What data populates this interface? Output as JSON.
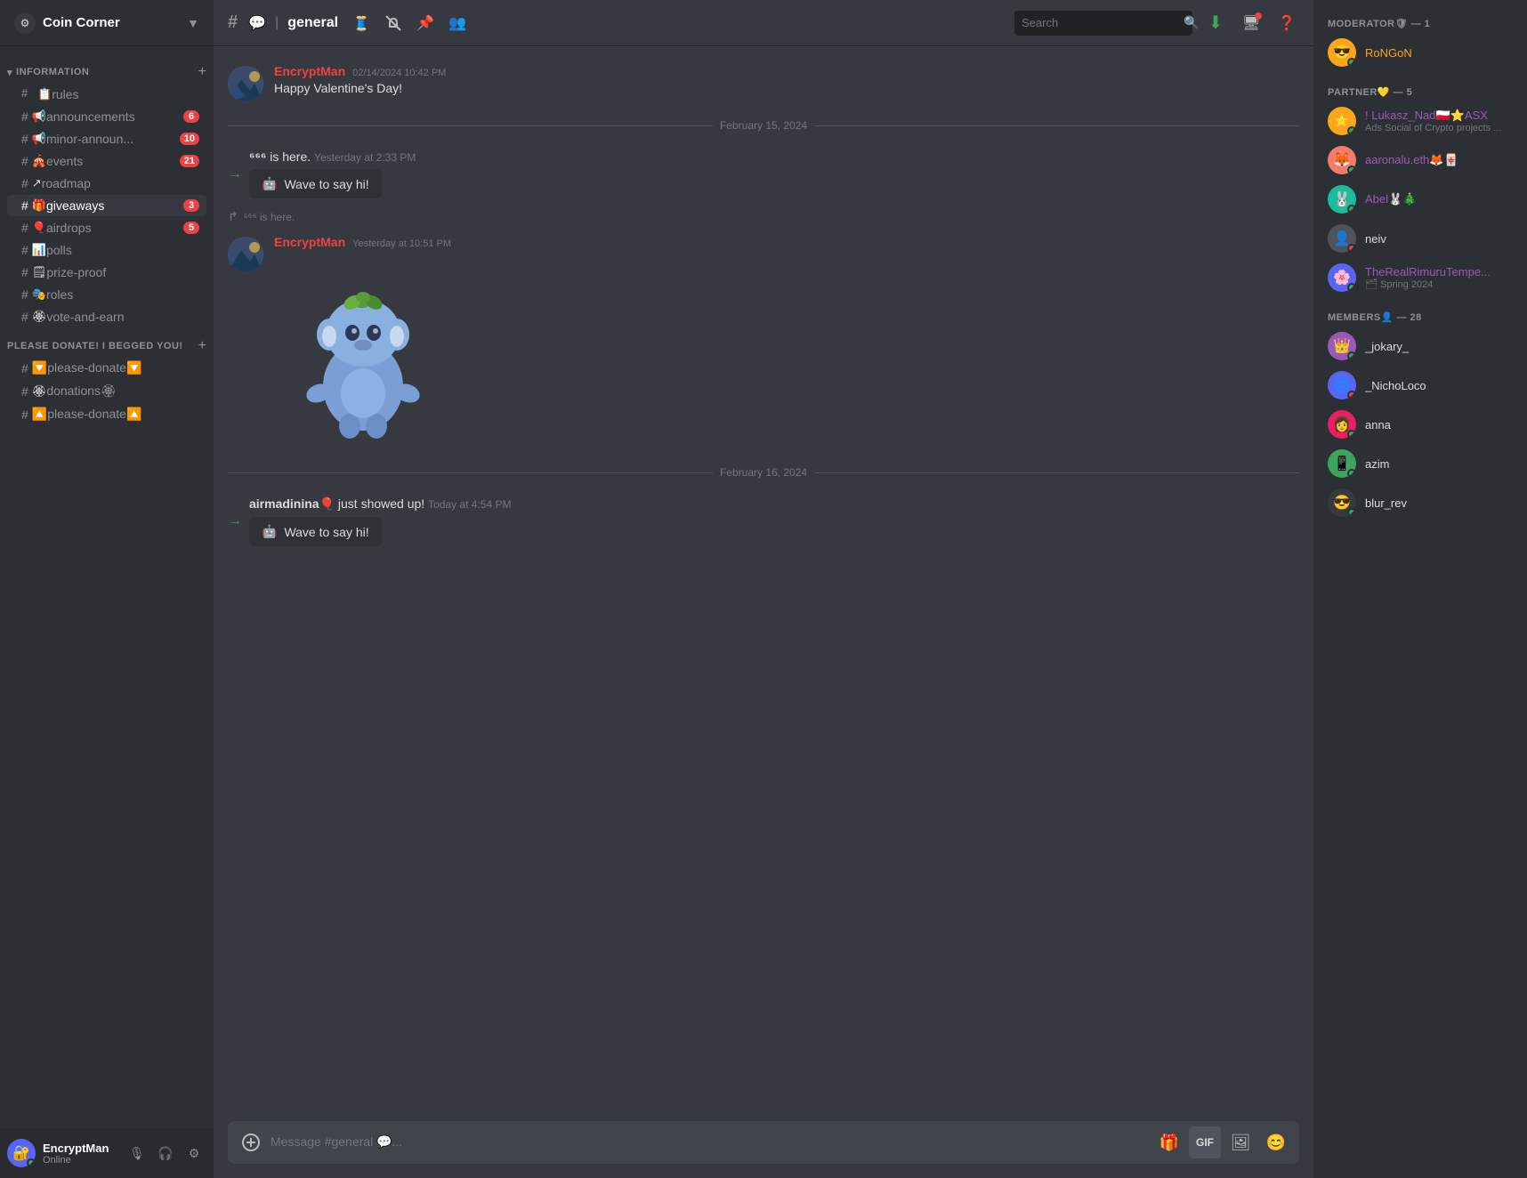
{
  "server": {
    "name": "Coin Corner",
    "icon": "⚙"
  },
  "sidebar": {
    "categories": [
      {
        "id": "information",
        "label": "INFORMATION",
        "collapsed": false,
        "channels": [
          {
            "id": "rules",
            "name": "rules",
            "icon": "📋",
            "type": "text",
            "badge": null,
            "emoji": ""
          },
          {
            "id": "announcements",
            "name": "announcements",
            "icon": "📢",
            "type": "text",
            "badge": 6,
            "emoji": ""
          },
          {
            "id": "minor-announ",
            "name": "minor-announ...",
            "icon": "📢",
            "type": "text",
            "badge": 10,
            "emoji": ""
          },
          {
            "id": "events",
            "name": "events",
            "icon": "🎪",
            "type": "text",
            "badge": 21,
            "emoji": ""
          },
          {
            "id": "roadmap",
            "name": "roadmap",
            "icon": "↗",
            "type": "text",
            "badge": null,
            "emoji": ""
          },
          {
            "id": "giveaways",
            "name": "giveaways",
            "icon": "🎁",
            "type": "text",
            "badge": 3,
            "emoji": ""
          },
          {
            "id": "airdrops",
            "name": "airdrops",
            "icon": "🎈",
            "type": "text",
            "badge": 5,
            "emoji": ""
          },
          {
            "id": "polls",
            "name": "polls",
            "icon": "📊",
            "type": "text",
            "badge": null,
            "emoji": ""
          },
          {
            "id": "prize-proof",
            "name": "prize-proof",
            "icon": "🗒",
            "type": "text",
            "badge": null,
            "emoji": ""
          },
          {
            "id": "roles",
            "name": "roles",
            "icon": "🎭",
            "type": "text",
            "badge": null,
            "emoji": ""
          },
          {
            "id": "vote-and-earn",
            "name": "vote-and-earn",
            "icon": "🏵",
            "type": "text",
            "badge": null,
            "emoji": ""
          }
        ]
      },
      {
        "id": "please-donate",
        "label": "PLEASE DONATE! I BEGGED YOU!",
        "collapsed": false,
        "channels": [
          {
            "id": "please-donate-1",
            "name": "🔽please-donate🔽",
            "icon": "",
            "type": "text",
            "badge": null
          },
          {
            "id": "donations",
            "name": "donations🏵",
            "icon": "🏵",
            "type": "text",
            "badge": null
          },
          {
            "id": "please-donate-2",
            "name": "🔼please-donate🔼",
            "icon": "",
            "type": "text",
            "badge": null
          }
        ]
      }
    ],
    "active_channel": "general"
  },
  "channel": {
    "name": "general",
    "hashtag": "#"
  },
  "header": {
    "channel_name": "general",
    "search_placeholder": "Search"
  },
  "messages": [
    {
      "id": "msg1",
      "type": "user",
      "author": "EncryptMan",
      "timestamp": "02/14/2024 10:42 PM",
      "text": "Happy Valentine's Day!",
      "has_image": true,
      "image_type": "avatar_landscape"
    },
    {
      "id": "sys1",
      "type": "system",
      "user": "666",
      "action": "is here.",
      "timestamp": "Yesterday at 2:33 PM",
      "wave": true
    },
    {
      "id": "msg2",
      "type": "user",
      "author": "EncryptMan",
      "timestamp": "Yesterday at 10:51 PM",
      "text": "",
      "has_character": true,
      "reply_text": "666 is here."
    },
    {
      "id": "sys2",
      "type": "system",
      "user": "airmadinina🎈",
      "action": "just showed up!",
      "timestamp": "Today at 4:54 PM",
      "wave": true
    }
  ],
  "date_dividers": [
    {
      "id": "div1",
      "text": "February 15, 2024"
    },
    {
      "id": "div2",
      "text": "February 16, 2024"
    }
  ],
  "input": {
    "placeholder": "Message #general 💬..."
  },
  "members": {
    "sections": [
      {
        "id": "moderators",
        "label": "MODERATOR🛡 — 1",
        "members": [
          {
            "id": "rongon",
            "name": "RoNGoN",
            "status": "online",
            "avatar_bg": "av-yellow",
            "emoji": "😎",
            "subtext": null
          }
        ]
      },
      {
        "id": "partners",
        "label": "PARTNER💛 — 5",
        "members": [
          {
            "id": "lukasz",
            "name": "! Lukasz_Nad🇵🇱⭐ASX",
            "status": "online",
            "avatar_bg": "av-yellow",
            "emoji": "⭐",
            "subtext": "Ads Social of Crypto projects ..."
          },
          {
            "id": "aaronalu",
            "name": "aaronalu.eth🦊🀄",
            "status": "online",
            "avatar_bg": "av-orange",
            "emoji": "🦊",
            "subtext": null
          },
          {
            "id": "abel",
            "name": "Abel🐰🎄",
            "status": "online",
            "avatar_bg": "av-teal",
            "emoji": "🐰",
            "subtext": null
          },
          {
            "id": "neiv",
            "name": "neiv",
            "status": "dnd",
            "avatar_bg": "av-gray",
            "emoji": "👤",
            "subtext": null
          },
          {
            "id": "thereal",
            "name": "TheRealRimuruTempe...",
            "status": "online",
            "avatar_bg": "av-blue",
            "emoji": "🌸",
            "subtext": "🗂 Spring 2024"
          }
        ]
      },
      {
        "id": "members",
        "label": "MEMBERS👤 — 28",
        "members": [
          {
            "id": "jokary",
            "name": "_jokary_",
            "status": "online",
            "avatar_bg": "av-purple",
            "emoji": "👑",
            "subtext": null
          },
          {
            "id": "nicholoco",
            "name": "_NichoLoco",
            "status": "dnd",
            "avatar_bg": "av-blue",
            "emoji": "🌀",
            "subtext": null
          },
          {
            "id": "anna",
            "name": "anna",
            "status": "online",
            "avatar_bg": "av-pink",
            "emoji": "👩",
            "subtext": null
          },
          {
            "id": "azim",
            "name": "azim",
            "status": "online",
            "avatar_bg": "av-green",
            "emoji": "📱",
            "subtext": null
          },
          {
            "id": "blur-rev",
            "name": "blur_rev",
            "status": "online",
            "avatar_bg": "av-dark",
            "emoji": "😎",
            "subtext": null
          }
        ]
      }
    ]
  },
  "user": {
    "name": "EncryptMan",
    "status": "Online"
  },
  "icons": {
    "threads": "🧵",
    "mute": "🔕",
    "pin": "📌",
    "members": "👥",
    "search": "🔍",
    "download": "⬇",
    "screen": "🖥",
    "help": "❓",
    "plus": "+",
    "gif": "GIF",
    "sticker": "🖼",
    "emoji": "😊",
    "mic_off": "🎙",
    "headphones": "🎧",
    "settings": "⚙",
    "hash": "#",
    "wave": "👋",
    "bot": "🤖",
    "chevron": "▼",
    "arrow": "→"
  }
}
